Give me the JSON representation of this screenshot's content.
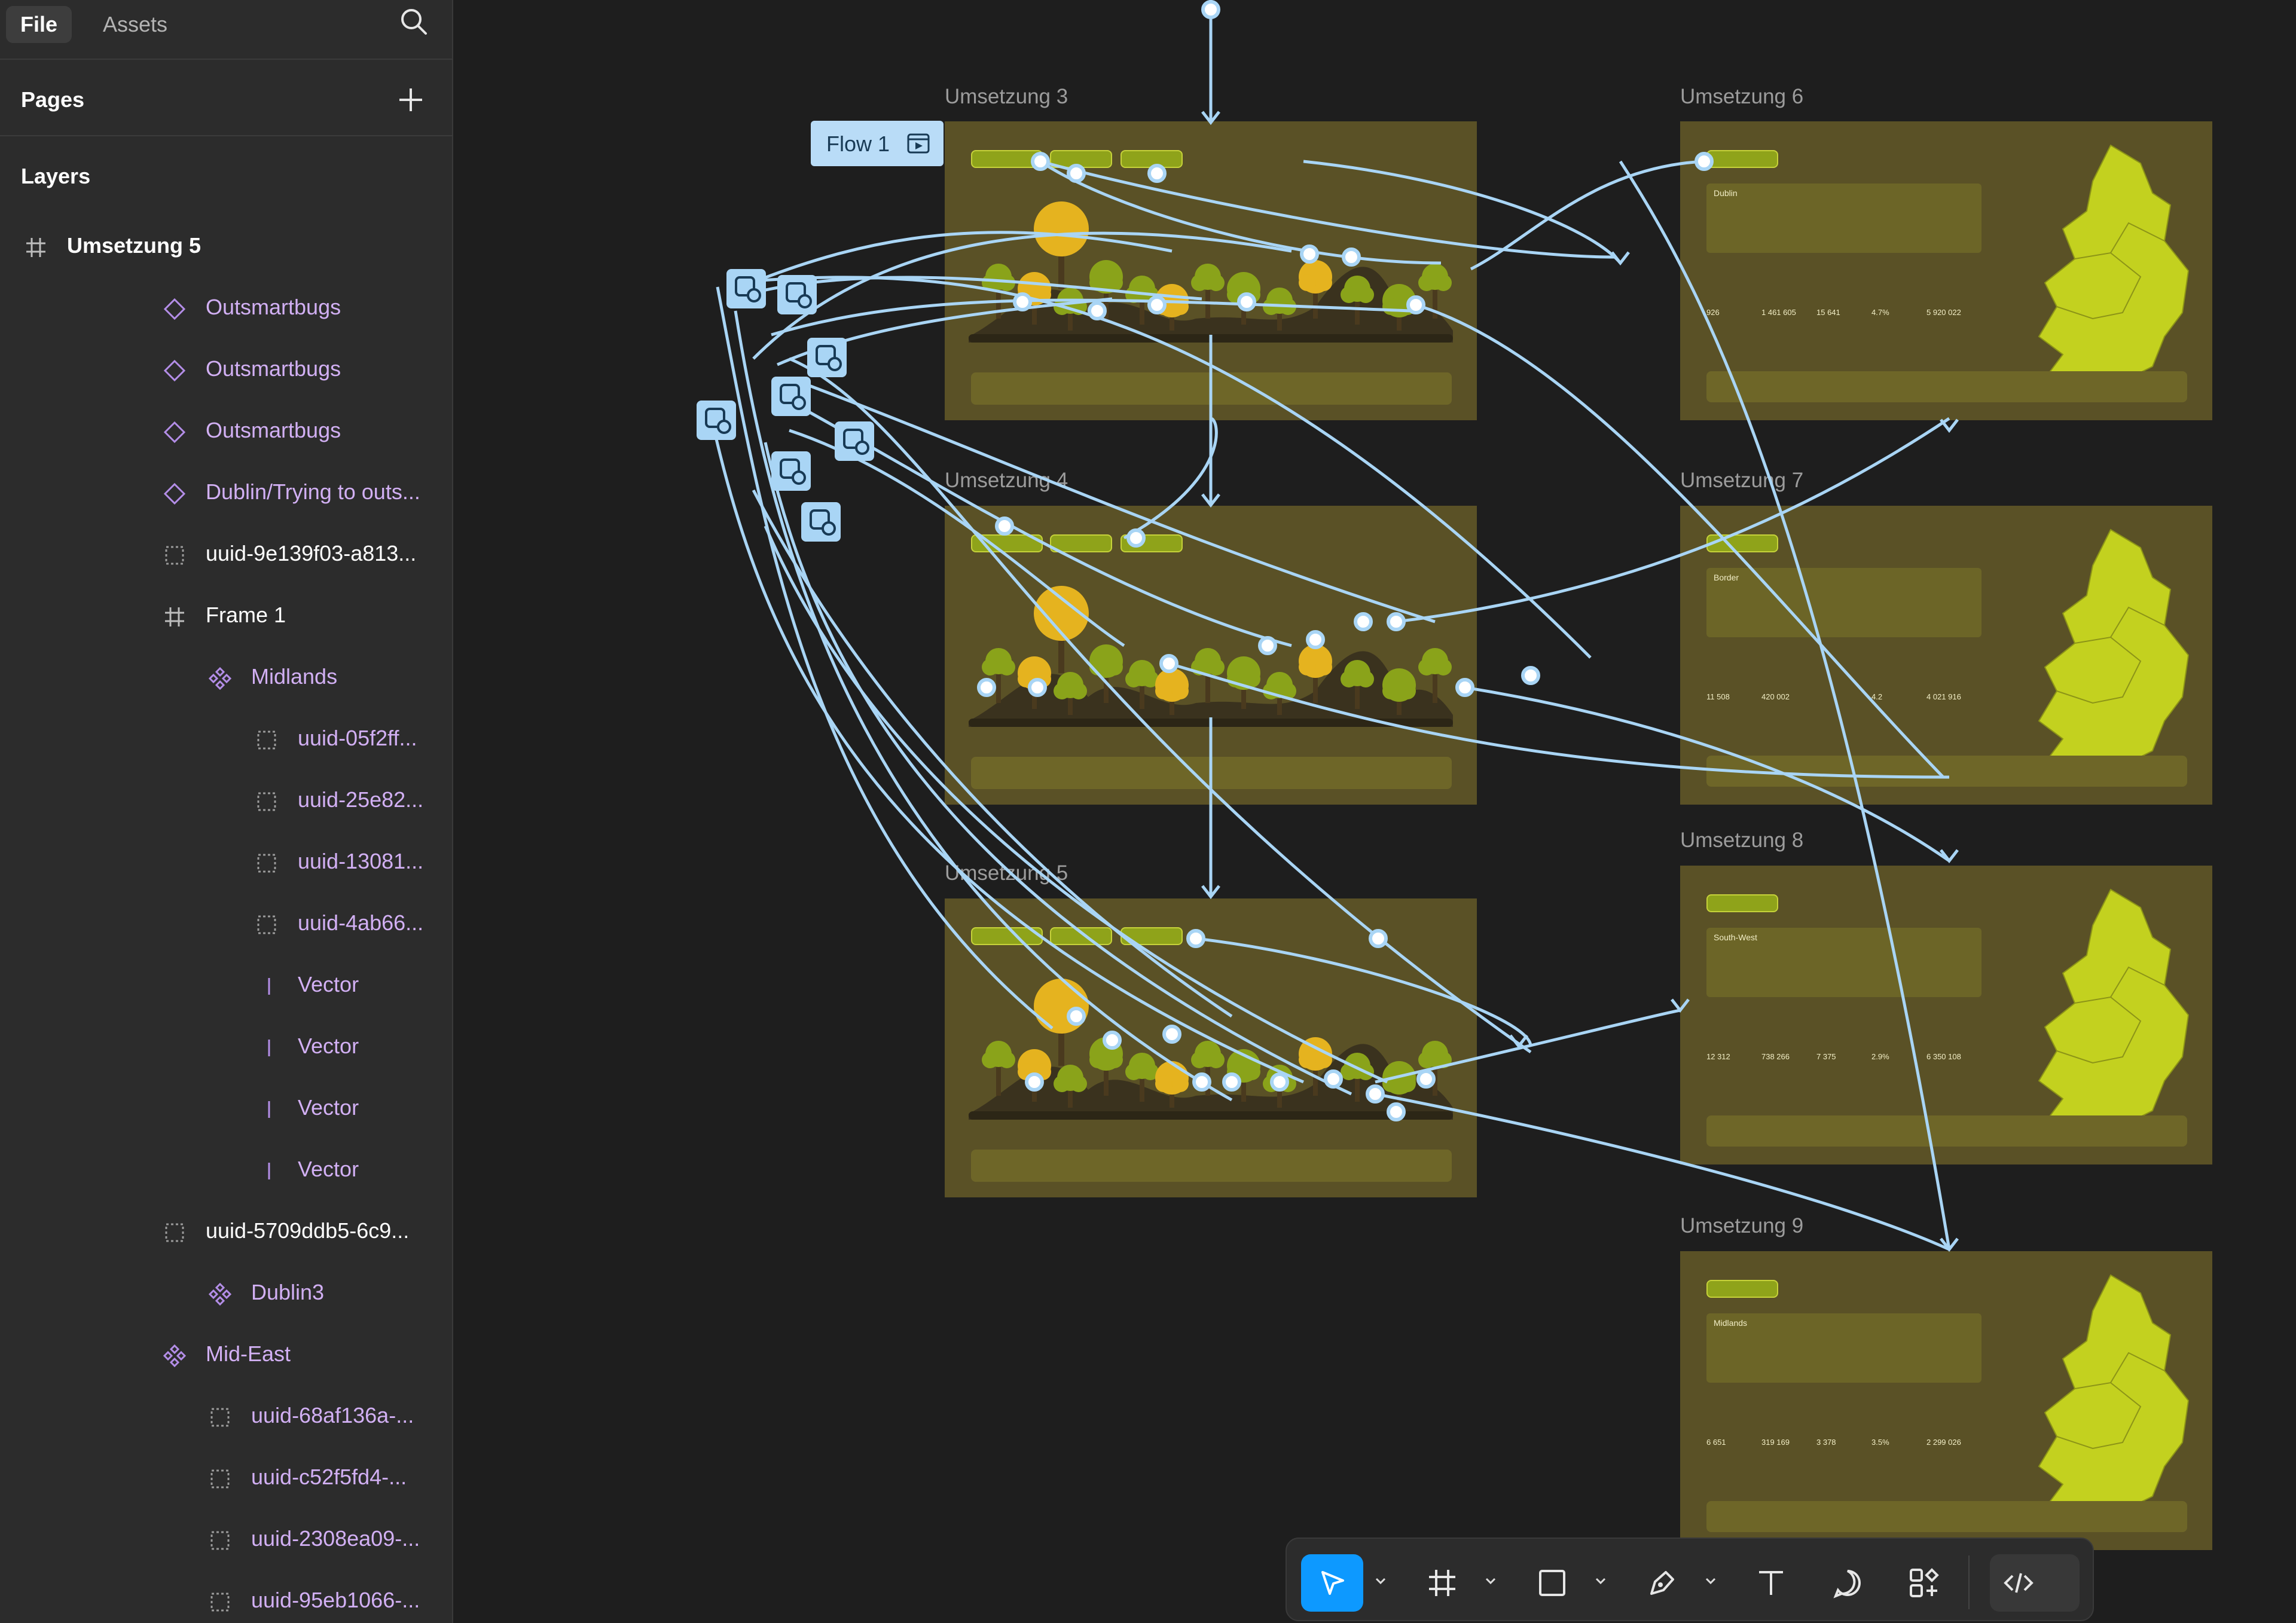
{
  "sidebar": {
    "tabs": [
      {
        "label": "File"
      },
      {
        "label": "Assets"
      }
    ],
    "search_icon": "search-icon",
    "pages_title": "Pages",
    "layers_title": "Layers",
    "current_frame": "Umsetzung 5",
    "layers": [
      {
        "label": "Outsmartbugs",
        "kind": "component",
        "color": "purple",
        "indent": 1
      },
      {
        "label": "Outsmartbugs",
        "kind": "component",
        "color": "purple",
        "indent": 1
      },
      {
        "label": "Outsmartbugs",
        "kind": "component",
        "color": "purple",
        "indent": 1
      },
      {
        "label": "Dublin/Trying to outs...",
        "kind": "component",
        "color": "purple",
        "indent": 1
      },
      {
        "label": "uuid-9e139f03-a813...",
        "kind": "group",
        "color": "white",
        "indent": 1
      },
      {
        "label": "Frame 1",
        "kind": "frame",
        "color": "white",
        "indent": 1
      },
      {
        "label": "Midlands",
        "kind": "instance",
        "color": "purple",
        "indent": 2
      },
      {
        "label": "uuid-05f2ff...",
        "kind": "group",
        "color": "purple",
        "indent": 3
      },
      {
        "label": "uuid-25e82...",
        "kind": "group",
        "color": "purple",
        "indent": 3
      },
      {
        "label": "uuid-13081...",
        "kind": "group",
        "color": "purple",
        "indent": 3
      },
      {
        "label": "uuid-4ab66...",
        "kind": "group",
        "color": "purple",
        "indent": 3
      },
      {
        "label": "Vector",
        "kind": "vector",
        "color": "purple",
        "indent": 3
      },
      {
        "label": "Vector",
        "kind": "vector",
        "color": "purple",
        "indent": 3
      },
      {
        "label": "Vector",
        "kind": "vector",
        "color": "purple",
        "indent": 3
      },
      {
        "label": "Vector",
        "kind": "vector",
        "color": "purple",
        "indent": 3
      },
      {
        "label": "uuid-5709ddb5-6c9...",
        "kind": "group",
        "color": "white",
        "indent": 1
      },
      {
        "label": "Dublin3",
        "kind": "instance",
        "color": "purple",
        "indent": 2
      },
      {
        "label": "Mid-East",
        "kind": "instance",
        "color": "purple",
        "indent": 1
      },
      {
        "label": "uuid-68af136a-...",
        "kind": "group",
        "color": "purple",
        "indent": 2
      },
      {
        "label": "uuid-c52f5fd4-...",
        "kind": "group",
        "color": "purple",
        "indent": 2
      },
      {
        "label": "uuid-2308ea09-...",
        "kind": "group",
        "color": "purple",
        "indent": 2
      },
      {
        "label": "uuid-95eb1066-...",
        "kind": "group",
        "color": "purple",
        "indent": 2
      }
    ]
  },
  "canvas": {
    "flow_label": "Flow 1",
    "frames": [
      {
        "id": "u3",
        "label": "Umsetzung 3",
        "type": "trees"
      },
      {
        "id": "u4",
        "label": "Umsetzung 4",
        "type": "trees"
      },
      {
        "id": "u5",
        "label": "Umsetzung 5",
        "type": "trees"
      },
      {
        "id": "u6",
        "label": "Umsetzung 6",
        "type": "map",
        "region": "Dublin",
        "stats": [
          "926",
          "1 461 605",
          "15 641",
          "4.7%",
          "5 920 022"
        ]
      },
      {
        "id": "u7",
        "label": "Umsetzung 7",
        "type": "map",
        "region": "Border",
        "stats": [
          "11 508",
          "420 002",
          "",
          "4.2",
          "4 021 916"
        ]
      },
      {
        "id": "u8",
        "label": "Umsetzung 8",
        "type": "map",
        "region": "South-West",
        "stats": [
          "12 312",
          "738 266",
          "7 375",
          "2.9%",
          "6 350 108"
        ]
      },
      {
        "id": "u9",
        "label": "Umsetzung 9",
        "type": "map",
        "region": "Midlands",
        "stats": [
          "6 651",
          "319 169",
          "3 378",
          "3.5%",
          "2 299 026"
        ]
      }
    ],
    "colors": {
      "canvas": "#1e1e1e",
      "frame": "#5a5126",
      "link": "#a9d5f5",
      "map": "#c3d11f",
      "tree": "#8aa31a",
      "accent_tree": "#e5b31f"
    }
  },
  "toolbar": {
    "tools": [
      "move-tool-icon",
      "frame-tool-icon",
      "rectangle-tool-icon",
      "pen-tool-icon",
      "text-tool-icon",
      "comment-tool-icon",
      "assets-tool-icon",
      "dev-mode-icon"
    ]
  }
}
